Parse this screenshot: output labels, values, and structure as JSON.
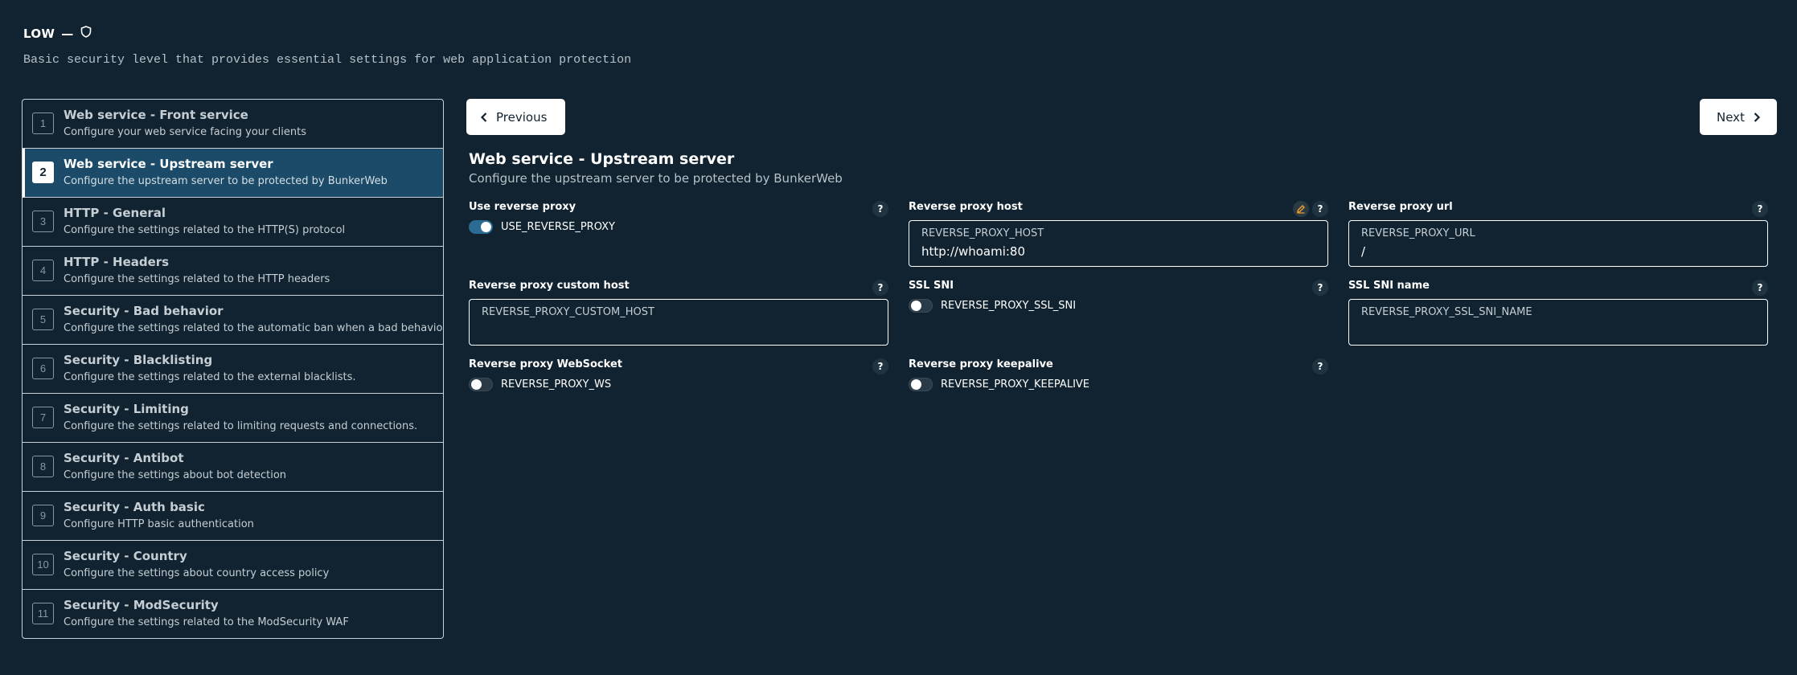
{
  "header": {
    "title": "LOW",
    "dash": "—",
    "description": "Basic security level that provides essential settings for web application protection"
  },
  "steps": [
    {
      "num": "1",
      "title": "Web service - Front service",
      "desc": "Configure your web service facing your clients"
    },
    {
      "num": "2",
      "title": "Web service - Upstream server",
      "desc": "Configure the upstream server to be protected by BunkerWeb"
    },
    {
      "num": "3",
      "title": "HTTP - General",
      "desc": "Configure the settings related to the HTTP(S) protocol"
    },
    {
      "num": "4",
      "title": "HTTP - Headers",
      "desc": "Configure the settings related to the HTTP headers"
    },
    {
      "num": "5",
      "title": "Security - Bad behavior",
      "desc": "Configure the settings related to the automatic ban when a bad behavior is de"
    },
    {
      "num": "6",
      "title": "Security - Blacklisting",
      "desc": "Configure the settings related to the external blacklists."
    },
    {
      "num": "7",
      "title": "Security - Limiting",
      "desc": "Configure the settings related to limiting requests and connections."
    },
    {
      "num": "8",
      "title": "Security - Antibot",
      "desc": "Configure the settings about bot detection"
    },
    {
      "num": "9",
      "title": "Security - Auth basic",
      "desc": "Configure HTTP basic authentication"
    },
    {
      "num": "10",
      "title": "Security - Country",
      "desc": "Configure the settings about country access policy"
    },
    {
      "num": "11",
      "title": "Security - ModSecurity",
      "desc": "Configure the settings related to the ModSecurity WAF"
    }
  ],
  "nav": {
    "previous": "Previous",
    "next": "Next"
  },
  "section": {
    "title": "Web service - Upstream server",
    "subtitle": "Configure the upstream server to be protected by BunkerWeb"
  },
  "fields": {
    "use_reverse_proxy": {
      "label": "Use reverse proxy",
      "setting": "USE_REVERSE_PROXY",
      "help": "?"
    },
    "reverse_proxy_host": {
      "label": "Reverse proxy host",
      "placeholder": "REVERSE_PROXY_HOST",
      "value": "http://whoami:80",
      "help": "?"
    },
    "reverse_proxy_url": {
      "label": "Reverse proxy url",
      "placeholder": "REVERSE_PROXY_URL",
      "value": "/",
      "help": "?"
    },
    "reverse_proxy_custom_host": {
      "label": "Reverse proxy custom host",
      "placeholder": "REVERSE_PROXY_CUSTOM_HOST",
      "value": "",
      "help": "?"
    },
    "ssl_sni": {
      "label": "SSL SNI",
      "setting": "REVERSE_PROXY_SSL_SNI",
      "help": "?"
    },
    "ssl_sni_name": {
      "label": "SSL SNI name",
      "placeholder": "REVERSE_PROXY_SSL_SNI_NAME",
      "value": "",
      "help": "?"
    },
    "reverse_proxy_ws": {
      "label": "Reverse proxy WebSocket",
      "setting": "REVERSE_PROXY_WS",
      "help": "?"
    },
    "reverse_proxy_keepalive": {
      "label": "Reverse proxy keepalive",
      "setting": "REVERSE_PROXY_KEEPALIVE",
      "help": "?"
    }
  }
}
